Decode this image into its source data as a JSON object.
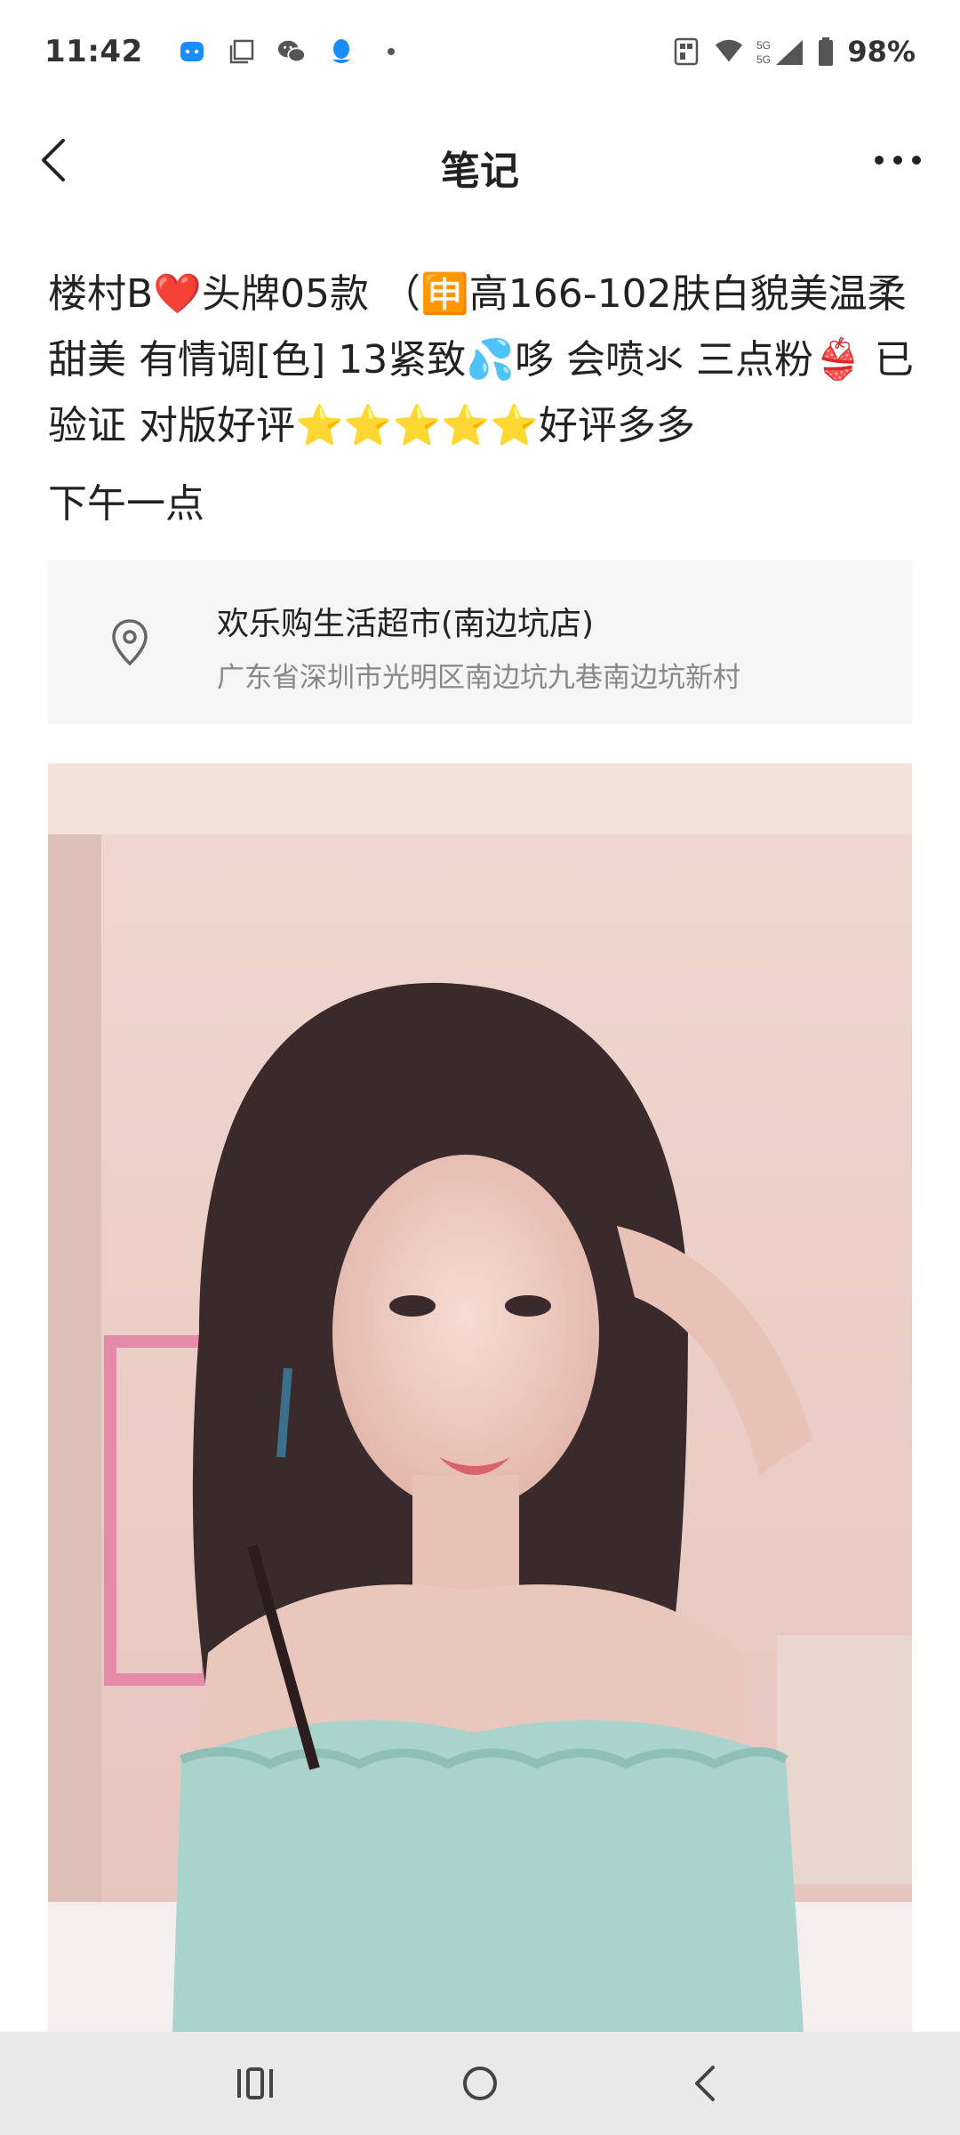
{
  "status_bar": {
    "time": "11:42",
    "battery": "98%",
    "network": "5G"
  },
  "header": {
    "title": "笔记"
  },
  "note": {
    "body": "楼村B❤️头牌05款 （🈸高166-102肤白貌美温柔甜美 有情调[色] 13紧致💦哆 会喷氺 三点粉👙 已验证 对版好评⭐⭐⭐⭐⭐好评多多",
    "time": "下午一点"
  },
  "location": {
    "name": "欢乐购生活超市(南边坑店)",
    "address": "广东省深圳市光明区南边坑九巷南边坑新村"
  },
  "icons": {
    "back": "back-arrow-icon",
    "more": "more-dots-icon",
    "location": "location-pin-icon"
  },
  "colors": {
    "card_bg": "#f5f5f5",
    "nav_bg": "#e9e9e9",
    "status_blue": "#1a8cff"
  }
}
